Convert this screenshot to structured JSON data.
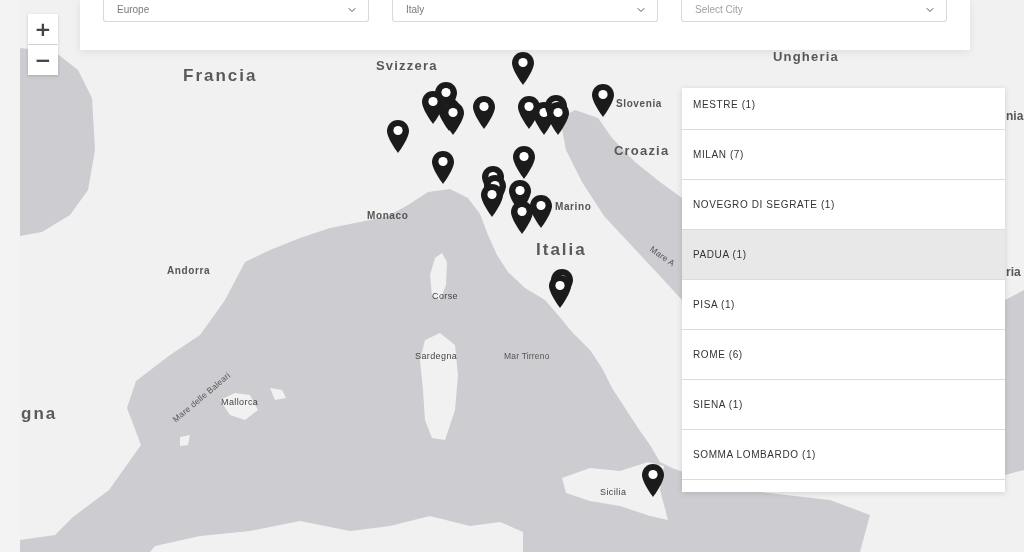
{
  "filters": [
    {
      "value": "Europe"
    },
    {
      "value": "Italy"
    },
    {
      "placeholder": "Select City"
    }
  ],
  "zoom_controls": {
    "zoom_in": "+",
    "zoom_out": "−"
  },
  "map": {
    "labels": [
      {
        "text": "Ungheria",
        "kind": "country"
      },
      {
        "text": "Svizzera",
        "kind": "country"
      },
      {
        "text": "Francia",
        "kind": "major"
      },
      {
        "text": "Slovenia",
        "kind": "place"
      },
      {
        "text": "nia",
        "kind": "country"
      },
      {
        "text": "Croazia",
        "kind": "country"
      },
      {
        "text": "Marino",
        "kind": "place"
      },
      {
        "text": "Monaco",
        "kind": "place"
      },
      {
        "text": "Italia",
        "kind": "major"
      },
      {
        "text": "Mare A",
        "kind": "sea"
      },
      {
        "text": "Andorra",
        "kind": "place"
      },
      {
        "text": "ria",
        "kind": "country"
      },
      {
        "text": "Corse",
        "kind": "island"
      },
      {
        "text": "Sardegna",
        "kind": "island"
      },
      {
        "text": "Mar Tirreno",
        "kind": "sea"
      },
      {
        "text": "Mare delle Baleari",
        "kind": "sea"
      },
      {
        "text": "Mallorca",
        "kind": "island"
      },
      {
        "text": "gna",
        "kind": "major"
      },
      {
        "text": "Sicilia",
        "kind": "island"
      }
    ]
  },
  "city_list": [
    {
      "label": "MESTRE (1)",
      "selected": false
    },
    {
      "label": "MILAN (7)",
      "selected": false
    },
    {
      "label": "NOVEGRO DI SEGRATE (1)",
      "selected": false
    },
    {
      "label": "PADUA (1)",
      "selected": true
    },
    {
      "label": "PISA (1)",
      "selected": false
    },
    {
      "label": "ROME (6)",
      "selected": false
    },
    {
      "label": "SIENA (1)",
      "selected": false
    },
    {
      "label": "SOMMA LOMBARDO (1)",
      "selected": false
    }
  ]
}
